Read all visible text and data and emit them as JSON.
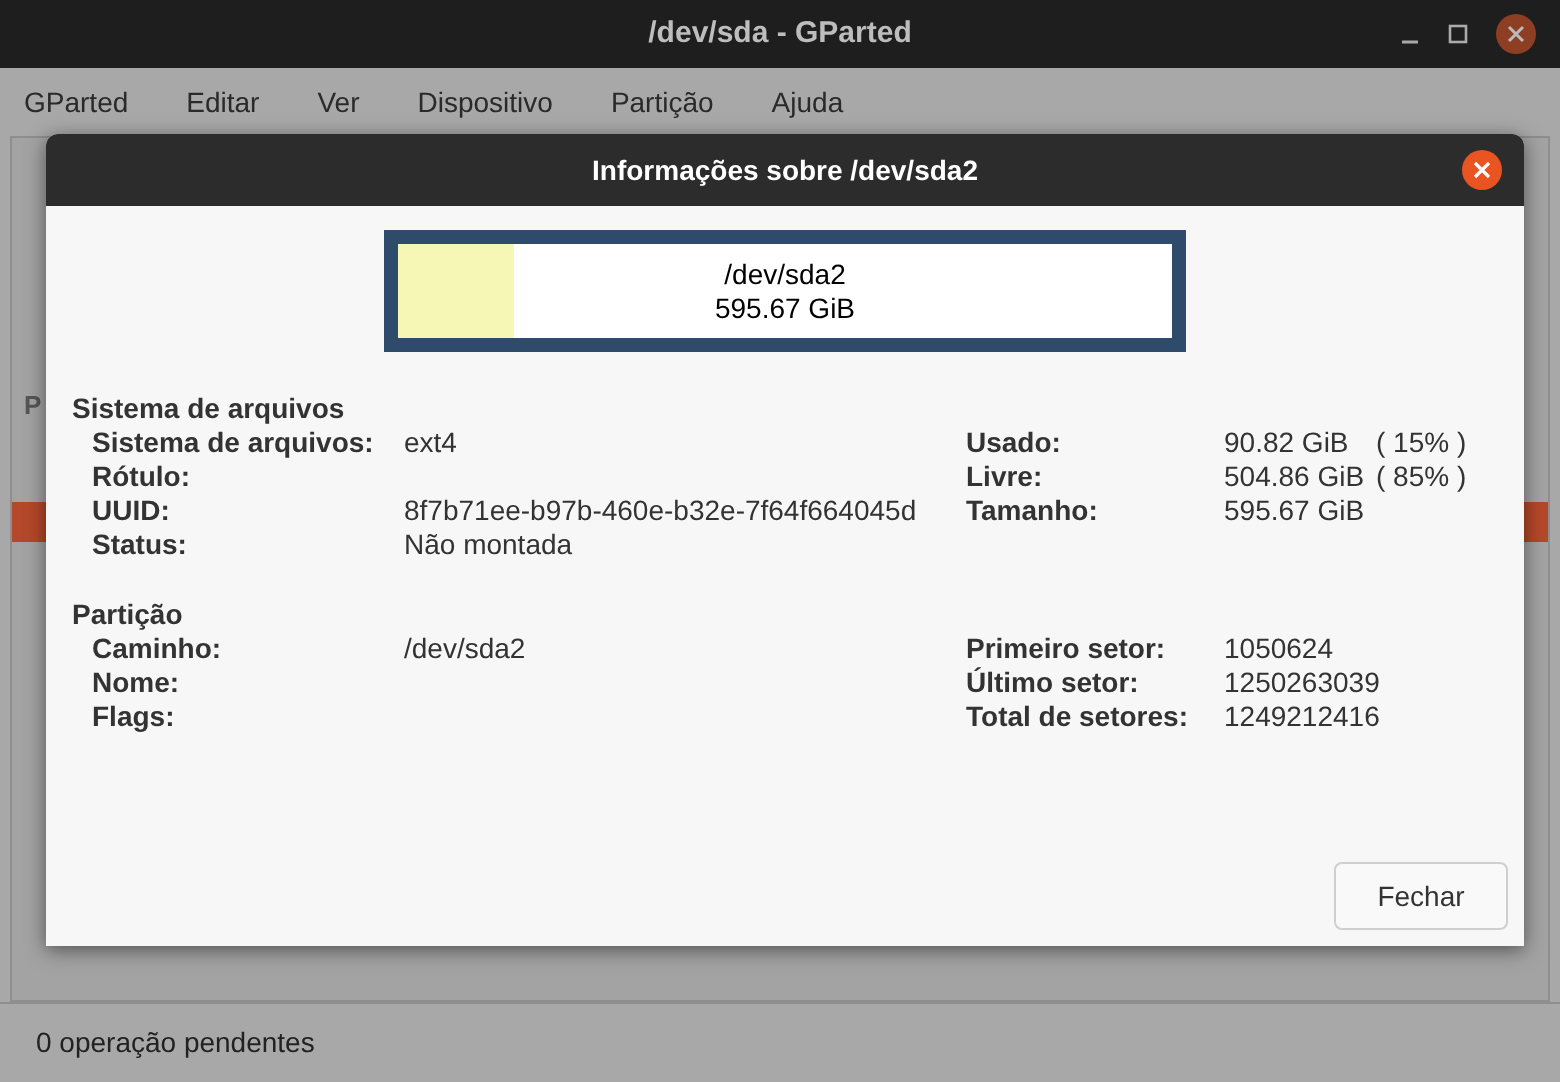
{
  "window": {
    "title": "/dev/sda - GParted"
  },
  "menu": [
    "GParted",
    "Editar",
    "Ver",
    "Dispositivo",
    "Partição",
    "Ajuda"
  ],
  "background_table": {
    "column_1": "P"
  },
  "status_bar": "0 operação pendentes",
  "dialog": {
    "title": "Informações sobre /dev/sda2",
    "usage": {
      "name": "/dev/sda2",
      "size": "595.67 GiB",
      "level": 0.15
    },
    "sections": [
      {
        "heading": "Sistema de arquivos",
        "left": [
          {
            "label": "Sistema de arquivos:",
            "value": "ext4"
          },
          {
            "label": "Rótulo:"
          },
          {
            "label": "UUID:",
            "value": "8f7b71ee-b97b-460e-b32e-7f64f664045d"
          },
          {
            "label": "Status:",
            "value": "Não montada"
          }
        ],
        "right": [
          {
            "label": "Usado:",
            "value": "90.82 GiB",
            "percent": "( 15% )"
          },
          {
            "label": "Livre:",
            "value": "504.86 GiB",
            "percent": "( 85% )"
          },
          {
            "label": "Tamanho:",
            "value": "595.67 GiB"
          }
        ]
      },
      {
        "heading": "Partição",
        "left": [
          {
            "label": "Caminho:",
            "value": "/dev/sda2"
          },
          {
            "label": "Nome:"
          },
          {
            "label": "Flags:"
          }
        ],
        "right": [
          {
            "label": "Primeiro setor:",
            "value": "1050624"
          },
          {
            "label": "Último setor:",
            "value": "1250263039"
          },
          {
            "label": "Total de setores:",
            "value": "1249212416"
          }
        ]
      }
    ],
    "button": "Fechar"
  }
}
